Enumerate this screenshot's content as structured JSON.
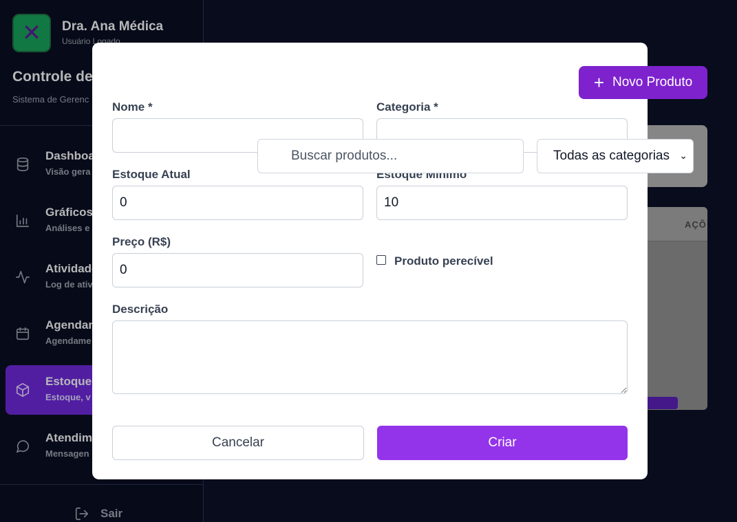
{
  "sidebar": {
    "user_name": "Dra. Ana Médica",
    "user_role": "Usuário Logado",
    "app_title": "Controle de",
    "app_subtitle": "Sistema de Gerenc",
    "items": [
      {
        "label": "Dashboar",
        "sub": "Visão gera",
        "icon": "database-icon"
      },
      {
        "label": "Gráficos",
        "sub": "Análises e",
        "icon": "bar-chart-icon"
      },
      {
        "label": "Atividade",
        "sub": "Log de ativ",
        "icon": "activity-icon"
      },
      {
        "label": "Agendam",
        "sub": "Agendame",
        "icon": "calendar-icon"
      },
      {
        "label": "Estoque",
        "sub": "Estoque, v",
        "icon": "package-icon",
        "active": true
      },
      {
        "label": "Atendime",
        "sub": "Mensagen",
        "icon": "message-circle-icon"
      }
    ],
    "logout_label": "Sair"
  },
  "main": {
    "new_product_label": "Novo Produto",
    "search_placeholder": "Buscar produtos...",
    "category_filter_value": "Todas as categorias",
    "table_header_actions": "AÇÕ"
  },
  "modal": {
    "name_label": "Nome *",
    "name_value": "",
    "category_label": "Categoria *",
    "category_value": "",
    "stock_current_label": "Estoque Atual",
    "stock_current_value": "0",
    "stock_min_label": "Estoque Mínimo",
    "stock_min_value": "10",
    "price_label": "Preço (R$)",
    "price_value": "0",
    "perishable_label": "Produto perecível",
    "perishable_checked": false,
    "description_label": "Descrição",
    "description_value": "",
    "cancel_label": "Cancelar",
    "create_label": "Criar"
  },
  "colors": {
    "accent": "#9333ea",
    "active_nav": "#6d28d9",
    "background": "#0b1026"
  }
}
